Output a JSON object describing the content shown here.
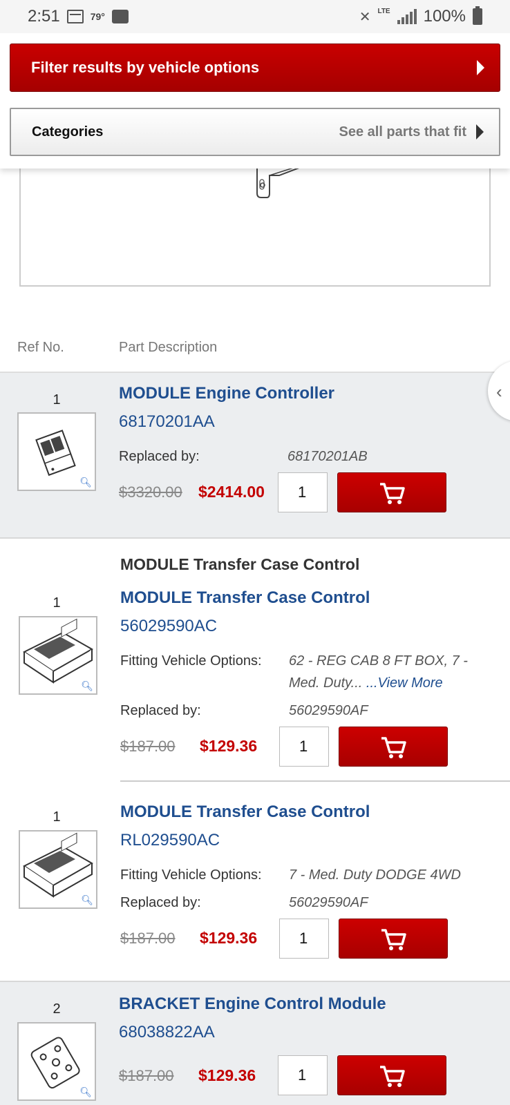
{
  "status_bar": {
    "time": "2:51",
    "temperature": "79°",
    "network": "LTE",
    "battery": "100%"
  },
  "filter_button": {
    "label": "Filter results by vehicle options"
  },
  "categories_bar": {
    "title": "Categories",
    "link": "See all parts that fit"
  },
  "table_header": {
    "ref_no": "Ref No.",
    "part_description": "Part Description"
  },
  "parts": [
    {
      "ref": "1",
      "title": "MODULE Engine Controller",
      "part_number": "68170201AA",
      "replaced_by_label": "Replaced by:",
      "replaced_by": "68170201AB",
      "old_price": "$3320.00",
      "new_price": "$2414.00",
      "qty": "1"
    },
    {
      "group_title": "MODULE Transfer Case Control",
      "ref": "1",
      "title": "MODULE Transfer Case Control",
      "part_number": "56029590AC",
      "fitting_label": "Fitting Vehicle Options:",
      "fitting_text": "62 - REG CAB 8 FT BOX, 7 - Med. Duty...",
      "view_more": "...View More",
      "replaced_by_label": "Replaced by:",
      "replaced_by": "56029590AF",
      "old_price": "$187.00",
      "new_price": "$129.36",
      "qty": "1"
    },
    {
      "ref": "1",
      "title": "MODULE Transfer Case Control",
      "part_number": "RL029590AC",
      "fitting_label": "Fitting Vehicle Options:",
      "fitting_text": "7 - Med. Duty DODGE 4WD",
      "replaced_by_label": "Replaced by:",
      "replaced_by": "56029590AF",
      "old_price": "$187.00",
      "new_price": "$129.36",
      "qty": "1"
    },
    {
      "ref": "2",
      "title": "BRACKET Engine Control Module",
      "part_number": "68038822AA",
      "old_price": "$187.00",
      "new_price": "$129.36",
      "qty": "1"
    }
  ],
  "colors": {
    "brand_red": "#c30000",
    "link_blue": "#1f4e8f",
    "row_gray": "#eceef0"
  }
}
